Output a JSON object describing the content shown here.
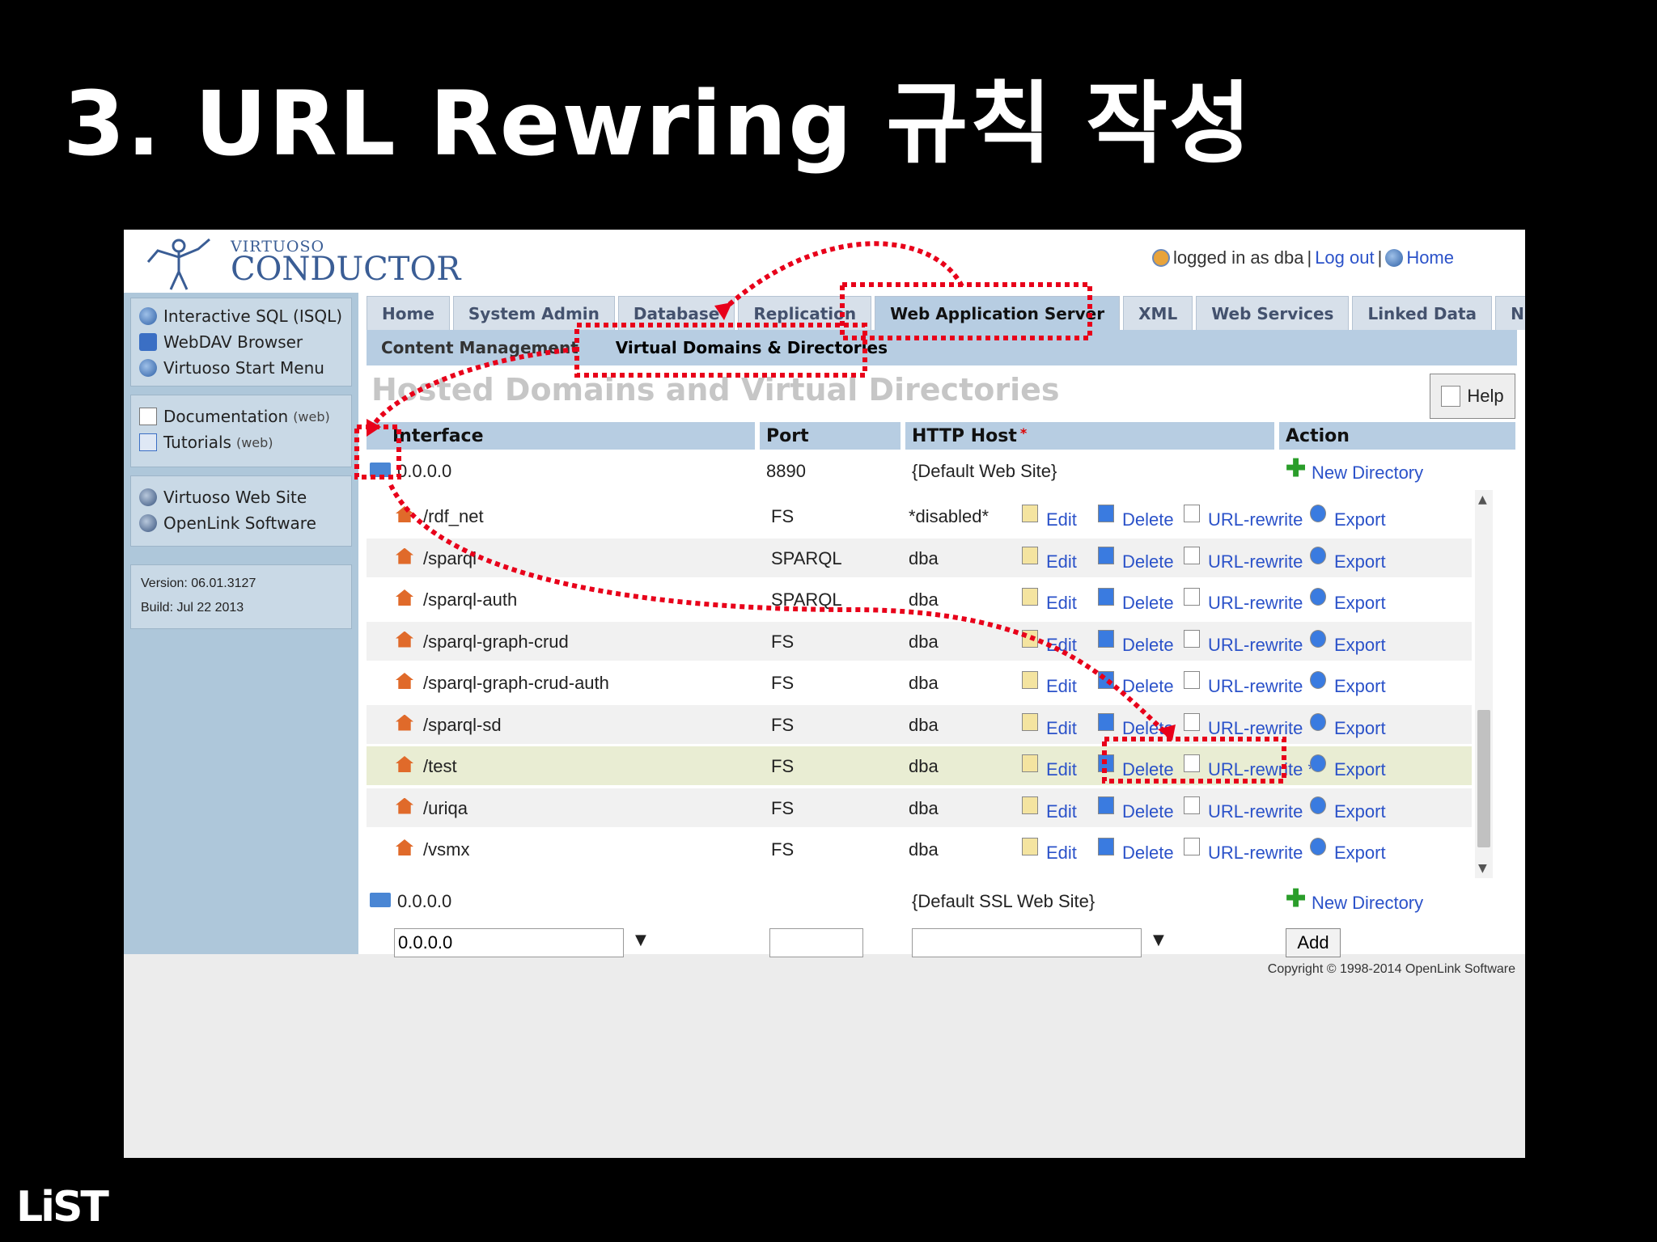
{
  "slide": {
    "title": "3. URL Rewring 규칙 작성",
    "logo_text": "LiST"
  },
  "header": {
    "logo_small": "VIRTUOSO",
    "logo_big": "CONDUCTOR",
    "logged_in": "logged in as dba",
    "separator": "|",
    "logout": "Log out",
    "home": "Home"
  },
  "sidebar": {
    "group1": [
      {
        "label": "Interactive SQL (ISQL)",
        "icon": "globe-icon"
      },
      {
        "label": "WebDAV Browser",
        "icon": "folder-icon"
      },
      {
        "label": "Virtuoso Start Menu",
        "icon": "globe-icon"
      }
    ],
    "group2": [
      {
        "label": "Documentation",
        "note": "(web)",
        "icon": "document-icon"
      },
      {
        "label": "Tutorials",
        "note": "(web)",
        "icon": "tutorial-icon"
      }
    ],
    "group3": [
      {
        "label": "Virtuoso Web Site",
        "icon": "globe-icon"
      },
      {
        "label": "OpenLink Software",
        "icon": "globe-icon"
      }
    ],
    "version": "Version: 06.01.3127",
    "build": "Build: Jul 22 2013"
  },
  "tabs": [
    "Home",
    "System Admin",
    "Database",
    "Replication",
    "Web Application Server",
    "XML",
    "Web Services",
    "Linked Data",
    "NNTP"
  ],
  "active_tab": "Web Application Server",
  "subtabs": [
    "Content Management",
    "Virtual Domains & Directories"
  ],
  "active_subtab": "Virtual Domains & Directories",
  "page_title": "Hosted Domains and Virtual Directories",
  "help_label": "Help",
  "table": {
    "headers": {
      "interface": "Interface",
      "port": "Port",
      "host": "HTTP Host",
      "required_mark": "*",
      "action": "Action"
    },
    "site1": {
      "interface": "0.0.0.0",
      "port": "8890",
      "host": "{Default Web Site}",
      "action": "New Directory"
    },
    "rows": [
      {
        "path": "/rdf_net",
        "type": "FS",
        "user": "*disabled*",
        "edit": "Edit",
        "delete": "Delete",
        "rewrite": "URL-rewrite",
        "export": "Export"
      },
      {
        "path": "/sparql",
        "type": "SPARQL",
        "user": "dba",
        "edit": "Edit",
        "delete": "Delete",
        "rewrite": "URL-rewrite",
        "export": "Export"
      },
      {
        "path": "/sparql-auth",
        "type": "SPARQL",
        "user": "dba",
        "edit": "Edit",
        "delete": "Delete",
        "rewrite": "URL-rewrite",
        "export": "Export"
      },
      {
        "path": "/sparql-graph-crud",
        "type": "FS",
        "user": "dba",
        "edit": "Edit",
        "delete": "Delete",
        "rewrite": "URL-rewrite",
        "export": "Export"
      },
      {
        "path": "/sparql-graph-crud-auth",
        "type": "FS",
        "user": "dba",
        "edit": "Edit",
        "delete": "Delete",
        "rewrite": "URL-rewrite",
        "export": "Export"
      },
      {
        "path": "/sparql-sd",
        "type": "FS",
        "user": "dba",
        "edit": "Edit",
        "delete": "Delete",
        "rewrite": "URL-rewrite",
        "export": "Export"
      },
      {
        "path": "/test",
        "type": "FS",
        "user": "dba",
        "edit": "Edit",
        "delete": "Delete",
        "rewrite": "URL-rewrite *",
        "export": "Export"
      },
      {
        "path": "/uriqa",
        "type": "FS",
        "user": "dba",
        "edit": "Edit",
        "delete": "Delete",
        "rewrite": "URL-rewrite",
        "export": "Export"
      },
      {
        "path": "/vsmx",
        "type": "FS",
        "user": "dba",
        "edit": "Edit",
        "delete": "Delete",
        "rewrite": "URL-rewrite",
        "export": "Export"
      }
    ],
    "site2": {
      "interface": "0.0.0.0",
      "host": "{Default SSL Web Site}",
      "action": "New Directory"
    },
    "new_row": {
      "interface_value": "0.0.0.0",
      "port_value": "",
      "host_value": "",
      "add_label": "Add"
    }
  },
  "copyright": "Copyright © 1998-2014 OpenLink Software",
  "colors": {
    "annotation_red": "#e8001a",
    "link_blue": "#2b52c9",
    "tab_bg": "#d7e0ea",
    "active_bg": "#b7cde2",
    "sidebar_bg": "#aec7da"
  }
}
